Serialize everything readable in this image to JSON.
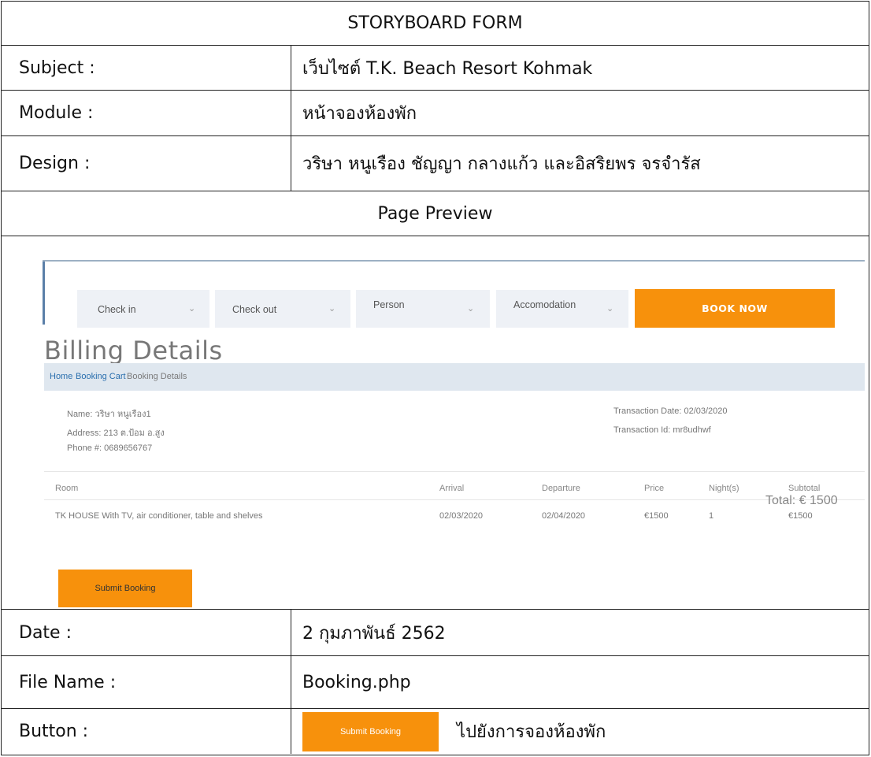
{
  "form": {
    "title": "STORYBOARD FORM",
    "subject_label": "Subject :",
    "subject_value": "เว็บไซต์ T.K. Beach Resort Kohmak",
    "module_label": "Module :",
    "module_value": "หน้าจองห้องพัก",
    "design_label": "Design :",
    "design_value": "วริษา หนูเรือง ชัญญา กลางแก้ว และอิสริยพร จรจำรัส",
    "preview_label": "Page Preview",
    "date_label": "Date :",
    "date_value": "2 กุมภาพันธ์ 2562",
    "filename_label": "File Name :",
    "filename_value": "Booking.php",
    "button_label": "Button :",
    "button_sample": "Submit Booking",
    "button_desc": "ไปยังการจองห้องพัก"
  },
  "preview": {
    "search": {
      "checkin": "Check in",
      "checkout": "Check out",
      "person": "Person",
      "accommodation": "Accomodation",
      "book_now": "BOOK NOW"
    },
    "title": "Billing Details",
    "breadcrumb": {
      "home": "Home",
      "cart": "Booking Cart",
      "current": "Booking Details"
    },
    "customer": {
      "name": "Name: วริษา หนูเรือง1",
      "address": "Address: 213 ต.ป้อม อ.สูง",
      "phone": "Phone #: 0689656767"
    },
    "transaction": {
      "date": "Transaction Date: 02/03/2020",
      "id": "Transaction Id: mr8udhwf"
    },
    "table": {
      "headers": {
        "room": "Room",
        "arrival": "Arrival",
        "departure": "Departure",
        "price": "Price",
        "nights": "Night(s)",
        "subtotal": "Subtotal"
      },
      "row": {
        "room": "TK HOUSE With TV, air conditioner, table and shelves",
        "arrival": "02/03/2020",
        "departure": "02/04/2020",
        "price": "€1500",
        "nights": "1",
        "subtotal": "€1500"
      }
    },
    "total": "Total: € 1500",
    "submit": "Submit Booking"
  }
}
